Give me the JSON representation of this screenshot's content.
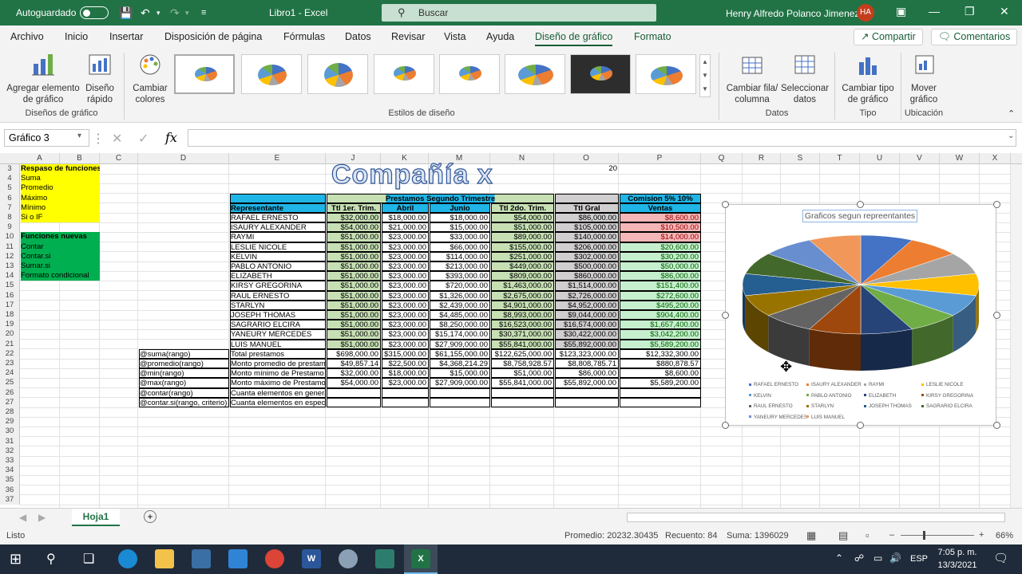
{
  "titlebar": {
    "autosave": "Autoguardado",
    "filename": "Libro1  -  Excel",
    "search_placeholder": "Buscar",
    "user": "Henry Alfredo Polanco Jimenez",
    "initials": "HA"
  },
  "menu": {
    "tabs": [
      "Archivo",
      "Inicio",
      "Insertar",
      "Disposición de página",
      "Fórmulas",
      "Datos",
      "Revisar",
      "Vista",
      "Ayuda",
      "Diseño de gráfico",
      "Formato"
    ],
    "share": "Compartir",
    "comments": "Comentarios"
  },
  "ribbon": {
    "add_element": "Agregar elemento de gráfico",
    "quick_layout": "Diseño rápido",
    "group_layouts": "Diseños de gráfico",
    "change_colors": "Cambiar colores",
    "group_styles": "Estilos de diseño",
    "switch_row": "Cambiar fila/ columna",
    "select_data": "Seleccionar datos",
    "group_data": "Datos",
    "change_type": "Cambiar tipo de gráfico",
    "group_type": "Tipo",
    "move_chart": "Mover gráfico",
    "group_location": "Ubicación"
  },
  "namebox": "Gráfico 3",
  "columns": [
    "A",
    "B",
    "C",
    "D",
    "E",
    "J",
    "K",
    "M",
    "N",
    "O",
    "P",
    "Q",
    "R",
    "S",
    "T",
    "U",
    "V",
    "W",
    "X"
  ],
  "rows": [
    "3",
    "4",
    "5",
    "6",
    "7",
    "8",
    "9",
    "10",
    "11",
    "12",
    "13",
    "14",
    "15",
    "16",
    "17",
    "18",
    "19",
    "20",
    "21",
    "22",
    "23",
    "24",
    "25",
    "26",
    "27",
    "28",
    "29",
    "30",
    "31",
    "32",
    "33",
    "34",
    "35",
    "36",
    "37"
  ],
  "sheet": {
    "company": "Compañía x",
    "o3": "20",
    "repaso_title": "Respaso de funciones",
    "repaso_items": [
      "Suma",
      "Promedio",
      "Máximo",
      "Mínimo",
      "Si o IF"
    ],
    "nuevas_title": "Funciones nuevas",
    "nuevas_items": [
      "Contar",
      "Contar.si",
      "Sumar.si",
      "Formato condicional"
    ],
    "hdr_top": "Prestamos Segundo Trimestre",
    "hdr_comm": "Comision 5%  10%",
    "headers": [
      "Representante",
      "Ttl 1er. Trim.",
      "Abril",
      "Junio",
      "Ttl 2do. Trim.",
      "Ttl Gral",
      "Ventas"
    ],
    "data": [
      [
        "RAFAEL ERNESTO",
        "$32,000.00",
        "$18,000.00",
        "$18,000.00",
        "$54,000.00",
        "$86,000.00",
        "$8,600.00"
      ],
      [
        "ISAURY ALEXANDER",
        "$54,000.00",
        "$21,000.00",
        "$15,000.00",
        "$51,000.00",
        "$105,000.00",
        "$10,500.00"
      ],
      [
        "RAYMI",
        "$51,000.00",
        "$23,000.00",
        "$33,000.00",
        "$89,000.00",
        "$140,000.00",
        "$14,000.00"
      ],
      [
        "LESLIE NICOLE",
        "$51,000.00",
        "$23,000.00",
        "$66,000.00",
        "$155,000.00",
        "$206,000.00",
        "$20,600.00"
      ],
      [
        "KELVIN",
        "$51,000.00",
        "$23,000.00",
        "$114,000.00",
        "$251,000.00",
        "$302,000.00",
        "$30,200.00"
      ],
      [
        "PABLO ANTONIO",
        "$51,000.00",
        "$23,000.00",
        "$213,000.00",
        "$449,000.00",
        "$500,000.00",
        "$50,000.00"
      ],
      [
        "ELIZABETH",
        "$51,000.00",
        "$23,000.00",
        "$393,000.00",
        "$809,000.00",
        "$860,000.00",
        "$86,000.00"
      ],
      [
        "KIRSY GREGORINA",
        "$51,000.00",
        "$23,000.00",
        "$720,000.00",
        "$1,463,000.00",
        "$1,514,000.00",
        "$151,400.00"
      ],
      [
        "RAUL ERNESTO",
        "$51,000.00",
        "$23,000.00",
        "$1,326,000.00",
        "$2,675,000.00",
        "$2,726,000.00",
        "$272,600.00"
      ],
      [
        "STARLYN",
        "$51,000.00",
        "$23,000.00",
        "$2,439,000.00",
        "$4,901,000.00",
        "$4,952,000.00",
        "$495,200.00"
      ],
      [
        "JOSEPH THOMAS",
        "$51,000.00",
        "$23,000.00",
        "$4,485,000.00",
        "$8,993,000.00",
        "$9,044,000.00",
        "$904,400.00"
      ],
      [
        "SAGRARIO ELCIRA",
        "$51,000.00",
        "$23,000.00",
        "$8,250,000.00",
        "$16,523,000.00",
        "$16,574,000.00",
        "$1,657,400.00"
      ],
      [
        "YANEURY MERCEDES",
        "$51,000.00",
        "$23,000.00",
        "$15,174,000.00",
        "$30,371,000.00",
        "$30,422,000.00",
        "$3,042,200.00"
      ],
      [
        "LUIS MANUEL",
        "$51,000.00",
        "$23,000.00",
        "$27,909,000.00",
        "$55,841,000.00",
        "$55,892,000.00",
        "$5,589,200.00"
      ]
    ],
    "summary": [
      [
        "@suma(rango)",
        "Total prestamos",
        "$698,000.00",
        "$315,000.00",
        "$61,155,000.00",
        "$122,625,000.00",
        "$123,323,000.00",
        "$12,332,300.00"
      ],
      [
        "@promedio(rango)",
        "Monto promedio de prestamo",
        "$49,857.14",
        "$22,500.00",
        "$4,368,214.29",
        "$8,758,928.57",
        "$8,808,785.71",
        "$880,878.57"
      ],
      [
        "@min(rango)",
        "Monto mínimo de Prestamo",
        "$32,000.00",
        "$18,000.00",
        "$15,000.00",
        "$51,000.00",
        "$86,000.00",
        "$8,600.00"
      ],
      [
        "@max(rango)",
        "Monto máximo de Prestamo",
        "$54,000.00",
        "$23,000.00",
        "$27,909,000.00",
        "$55,841,000.00",
        "$55,892,000.00",
        "$5,589,200.00"
      ],
      [
        "@contar(rango)",
        "Cuanta elementos en general",
        "",
        "",
        "",
        "",
        "",
        ""
      ],
      [
        "@contar.si(rango, criterio)",
        "Cuanta elementos en especifico",
        "",
        "",
        "",
        "",
        "",
        ""
      ]
    ]
  },
  "chart": {
    "title": "Graficos segun repreentantes"
  },
  "chart_data": {
    "type": "pie",
    "title": "Graficos segun repreentantes",
    "categories": [
      "RAFAEL ERNESTO",
      "ISAURY ALEXANDER",
      "RAYMI",
      "LESLIE NICOLE",
      "KELVIN",
      "PABLO ANTONIO",
      "ELIZABETH",
      "KIRSY GREGORINA",
      "RAUL ERNESTO",
      "STARLYN",
      "JOSEPH THOMAS",
      "SAGRARIO ELCIRA",
      "YANEURY MERCEDES",
      "LUIS MANUEL"
    ],
    "values": [
      1,
      1,
      1,
      1,
      1,
      1,
      1,
      1,
      1,
      1,
      1,
      1,
      1,
      1
    ],
    "colors": [
      "#4472c4",
      "#ed7d31",
      "#a5a5a5",
      "#ffc000",
      "#5b9bd5",
      "#70ad47",
      "#264478",
      "#9e480e",
      "#636363",
      "#997300",
      "#255e91",
      "#43682b",
      "#698ed0",
      "#f1975a"
    ],
    "legend": "bottom"
  },
  "sheettab": "Hoja1",
  "status": {
    "ready": "Listo",
    "avg": "Promedio: 20232.30435",
    "count": "Recuento: 84",
    "sum": "Suma: 1396029",
    "zoom": "66%"
  },
  "taskbar": {
    "lang": "ESP",
    "time": "7:05 p. m.",
    "date": "13/3/2021"
  }
}
